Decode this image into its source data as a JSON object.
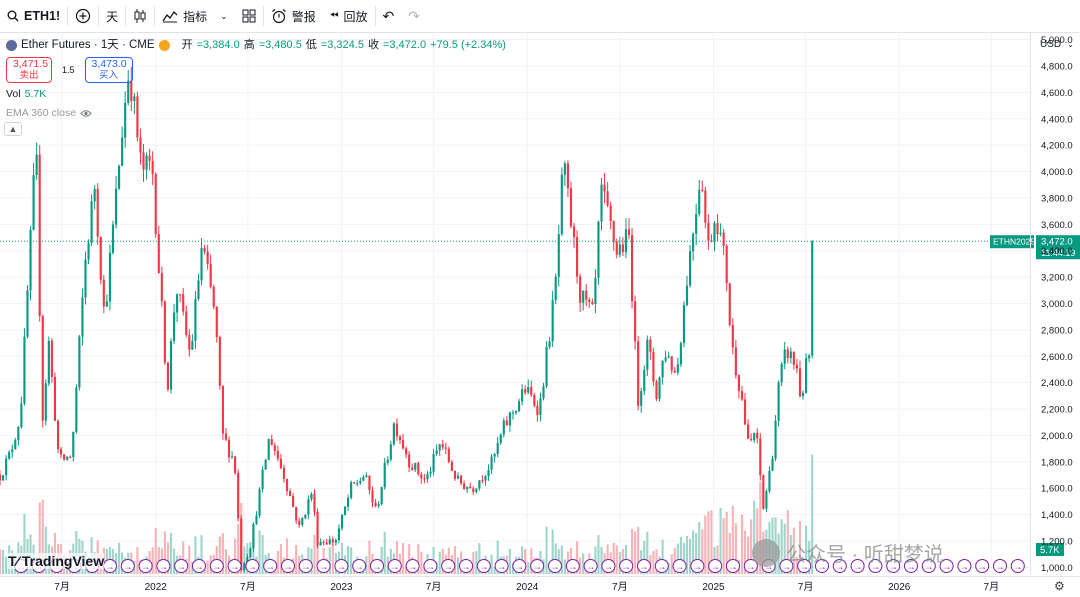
{
  "toolbar": {
    "symbol": "ETH1!",
    "interval": "天",
    "indicators_label": "指标",
    "alert_label": "警报",
    "replay_label": "回放"
  },
  "legend": {
    "title": "Ether Futures · 1天 · CME",
    "ohlc": [
      {
        "label": "开",
        "value": "=3,384.0"
      },
      {
        "label": "高",
        "value": "=3,480.5"
      },
      {
        "label": "低",
        "value": "=3,324.5"
      },
      {
        "label": "收",
        "value": "=3,472.0"
      }
    ],
    "change": "+79.5 (+2.34%)",
    "sell_price": "3,471.5",
    "sell_label": "卖出",
    "spread": "1.5",
    "buy_price": "3,473.0",
    "buy_label": "买入",
    "vol_label": "Vol",
    "vol_value": "5.7K",
    "ema_label": "EMA 360 close"
  },
  "price_axis": {
    "currency": "USD",
    "last_symbol": "ETHN2025",
    "last_price": "3,472.0",
    "countdown": "11:44:19",
    "volume_badge": "5.7K"
  },
  "branding": {
    "logo": "TradingView",
    "watermark": "公众号 · 听甜梦说"
  },
  "colors": {
    "up": "#089981",
    "down": "#f23645",
    "vol_up": "#9fd5ca",
    "vol_down": "#f6b3b8",
    "accent": "#2962ff",
    "event_marker": "#7b1fa2"
  },
  "chart_data": {
    "type": "candlestick",
    "title": "Ether Futures · 1天 · CME",
    "ylim": [
      950,
      5050
    ],
    "y_ticks": [
      1000,
      1200,
      1400,
      1600,
      1800,
      2000,
      2200,
      2400,
      2600,
      2800,
      3000,
      3200,
      3400,
      3600,
      3800,
      4000,
      4200,
      4400,
      4600,
      4800,
      5000
    ],
    "y_tick_labels": [
      "1,000.0",
      "1,200.0",
      "1,400.0",
      "1,600.0",
      "1,800.0",
      "2,000.0",
      "2,200.0",
      "2,400.0",
      "2,600.0",
      "2,800.0",
      "3,000.0",
      "3,200.0",
      "3,400.0",
      "3,600.0",
      "3,800.0",
      "4,000.0",
      "4,200.0",
      "4,400.0",
      "4,600.0",
      "4,800.0",
      "5,000.0"
    ],
    "x_range": [
      "2021-03-01",
      "2026-09-15"
    ],
    "x_ticks": [
      {
        "date": "2021-07-01",
        "label": "7月"
      },
      {
        "date": "2022-01-01",
        "label": "2022"
      },
      {
        "date": "2022-07-01",
        "label": "7月"
      },
      {
        "date": "2023-01-01",
        "label": "2023"
      },
      {
        "date": "2023-07-01",
        "label": "7月"
      },
      {
        "date": "2024-01-01",
        "label": "2024"
      },
      {
        "date": "2024-07-01",
        "label": "7月"
      },
      {
        "date": "2025-01-01",
        "label": "2025"
      },
      {
        "date": "2025-07-01",
        "label": "7月"
      },
      {
        "date": "2026-01-01",
        "label": "2026"
      },
      {
        "date": "2026-07-01",
        "label": "7月"
      }
    ],
    "last_close": 3472.0,
    "price_path": [
      [
        "2021-03-01",
        1700
      ],
      [
        "2021-03-20",
        1850
      ],
      [
        "2021-04-10",
        2150
      ],
      [
        "2021-05-11",
        4200
      ],
      [
        "2021-05-23",
        2100
      ],
      [
        "2021-06-05",
        2700
      ],
      [
        "2021-06-25",
        1800
      ],
      [
        "2021-07-20",
        1850
      ],
      [
        "2021-08-15",
        3300
      ],
      [
        "2021-09-03",
        3900
      ],
      [
        "2021-09-22",
        2900
      ],
      [
        "2021-10-10",
        3600
      ],
      [
        "2021-10-29",
        4400
      ],
      [
        "2021-11-10",
        4800
      ],
      [
        "2021-12-04",
        4000
      ],
      [
        "2021-12-25",
        4050
      ],
      [
        "2022-01-10",
        3100
      ],
      [
        "2022-01-24",
        2350
      ],
      [
        "2022-02-10",
        3150
      ],
      [
        "2022-03-10",
        2600
      ],
      [
        "2022-04-02",
        3450
      ],
      [
        "2022-04-28",
        2900
      ],
      [
        "2022-05-12",
        2000
      ],
      [
        "2022-06-05",
        1800
      ],
      [
        "2022-06-18",
        1000
      ],
      [
        "2022-07-05",
        1150
      ],
      [
        "2022-08-13",
        2000
      ],
      [
        "2022-09-10",
        1700
      ],
      [
        "2022-10-10",
        1300
      ],
      [
        "2022-11-06",
        1600
      ],
      [
        "2022-11-12",
        1200
      ],
      [
        "2022-12-20",
        1200
      ],
      [
        "2023-01-20",
        1600
      ],
      [
        "2023-02-15",
        1700
      ],
      [
        "2023-03-10",
        1420
      ],
      [
        "2023-04-15",
        2100
      ],
      [
        "2023-05-15",
        1800
      ],
      [
        "2023-06-15",
        1650
      ],
      [
        "2023-07-15",
        1950
      ],
      [
        "2023-08-17",
        1650
      ],
      [
        "2023-09-15",
        1600
      ],
      [
        "2023-10-25",
        1800
      ],
      [
        "2023-11-15",
        2050
      ],
      [
        "2023-12-28",
        2350
      ],
      [
        "2024-01-25",
        2200
      ],
      [
        "2024-02-25",
        3100
      ],
      [
        "2024-03-12",
        4050
      ],
      [
        "2024-04-15",
        3050
      ],
      [
        "2024-05-10",
        2900
      ],
      [
        "2024-05-25",
        3850
      ],
      [
        "2024-06-25",
        3400
      ],
      [
        "2024-07-20",
        3500
      ],
      [
        "2024-08-05",
        2250
      ],
      [
        "2024-08-25",
        2700
      ],
      [
        "2024-09-10",
        2300
      ],
      [
        "2024-09-28",
        2650
      ],
      [
        "2024-10-20",
        2450
      ],
      [
        "2024-11-10",
        3200
      ],
      [
        "2024-12-08",
        4050
      ],
      [
        "2024-12-20",
        3400
      ],
      [
        "2025-01-06",
        3700
      ],
      [
        "2025-01-26",
        3250
      ],
      [
        "2025-02-05",
        2700
      ],
      [
        "2025-02-25",
        2300
      ],
      [
        "2025-03-11",
        1900
      ],
      [
        "2025-03-25",
        2050
      ],
      [
        "2025-04-09",
        1450
      ],
      [
        "2025-04-25",
        1800
      ],
      [
        "2025-05-10",
        2400
      ],
      [
        "2025-05-25",
        2650
      ],
      [
        "2025-06-15",
        2500
      ],
      [
        "2025-06-22",
        2250
      ],
      [
        "2025-07-01",
        2500
      ],
      [
        "2025-07-08",
        2600
      ],
      [
        "2025-07-13",
        3000
      ],
      [
        "2025-07-17",
        3472
      ]
    ],
    "markers": [
      "→",
      "→",
      "→",
      "→",
      "→",
      "→",
      "→",
      "→",
      "→",
      "→",
      "→",
      "→",
      "→",
      "→",
      "→",
      "→",
      "→",
      "→",
      "→",
      "→",
      "→",
      "→",
      "→",
      "→",
      "→",
      "→",
      "→",
      "→",
      "→",
      "→",
      "→",
      "→",
      "→",
      "→",
      "→",
      "→",
      "→",
      "→",
      "→",
      "→",
      "→",
      "→",
      "→",
      "→",
      "→",
      "→",
      "→",
      "→",
      "→",
      "→",
      "→",
      "→",
      "→",
      "→",
      "→",
      "→",
      "→",
      "→"
    ]
  }
}
